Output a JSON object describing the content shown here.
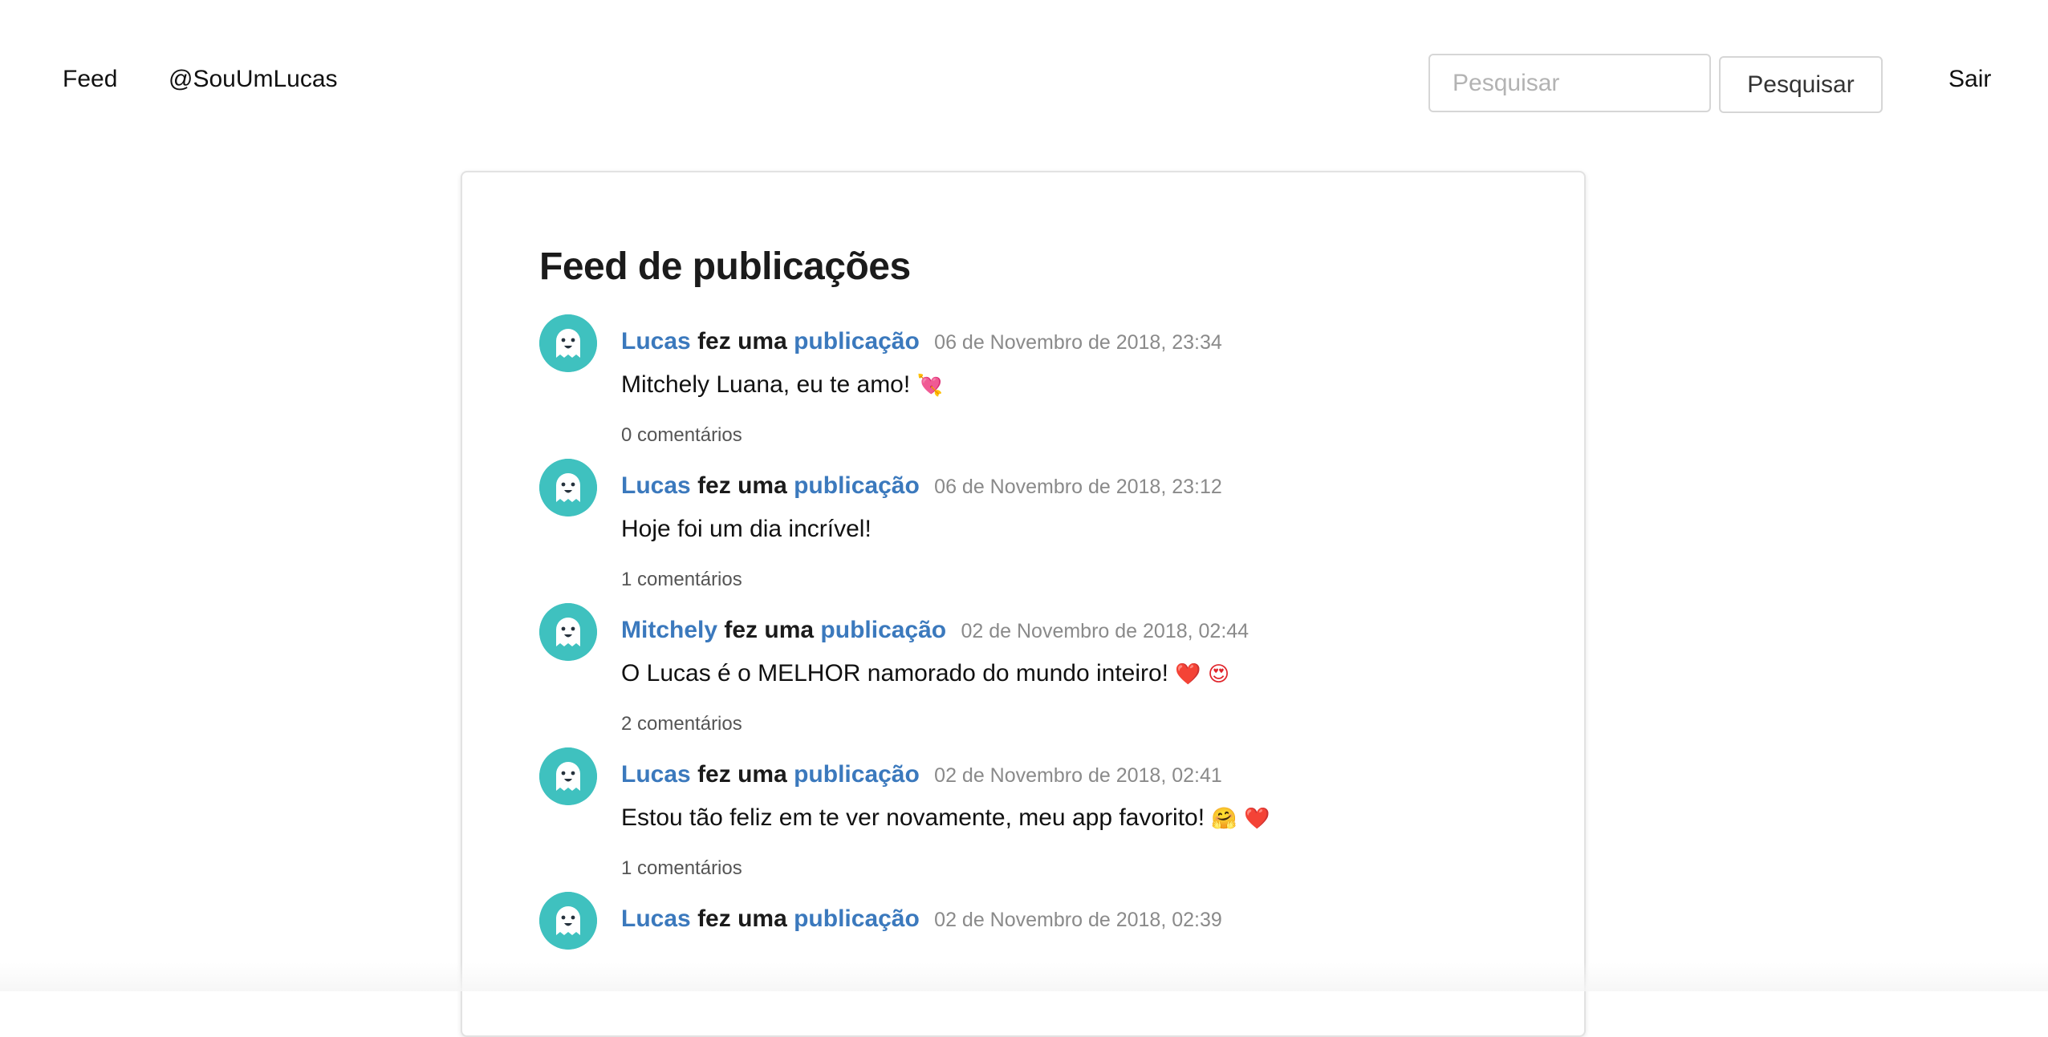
{
  "nav": {
    "feed_label": "Feed",
    "user_label": "@SouUmLucas",
    "logout_label": "Sair"
  },
  "search": {
    "placeholder": "Pesquisar",
    "value": "",
    "button_label": "Pesquisar"
  },
  "feed": {
    "title": "Feed de publicações",
    "action_text": "fez uma",
    "link_text": "publicação",
    "posts": [
      {
        "author": "Lucas",
        "timestamp": "06 de Novembro de 2018, 23:34",
        "text": "Mitchely Luana, eu te amo!",
        "emojis": "💘",
        "comments": "0 comentários"
      },
      {
        "author": "Lucas",
        "timestamp": "06 de Novembro de 2018, 23:12",
        "text": "Hoje foi um dia incrível!",
        "emojis": "",
        "comments": "1 comentários"
      },
      {
        "author": "Mitchely",
        "timestamp": "02 de Novembro de 2018, 02:44",
        "text": "O Lucas é o MELHOR namorado do mundo inteiro!",
        "emojis": "❤️ 😍",
        "comments": "2 comentários"
      },
      {
        "author": "Lucas",
        "timestamp": "02 de Novembro de 2018, 02:41",
        "text": "Estou tão feliz em te ver novamente, meu app favorito!",
        "emojis": "🤗 ❤️",
        "comments": "1 comentários"
      },
      {
        "author": "Lucas",
        "timestamp": "02 de Novembro de 2018, 02:39",
        "text": "",
        "emojis": "",
        "comments": ""
      }
    ]
  },
  "colors": {
    "link": "#3b79bd",
    "avatar_bg": "#3fc1bf",
    "timestamp": "#8a8a8a"
  },
  "icons": {
    "avatar": "ghost-avatar-icon"
  }
}
